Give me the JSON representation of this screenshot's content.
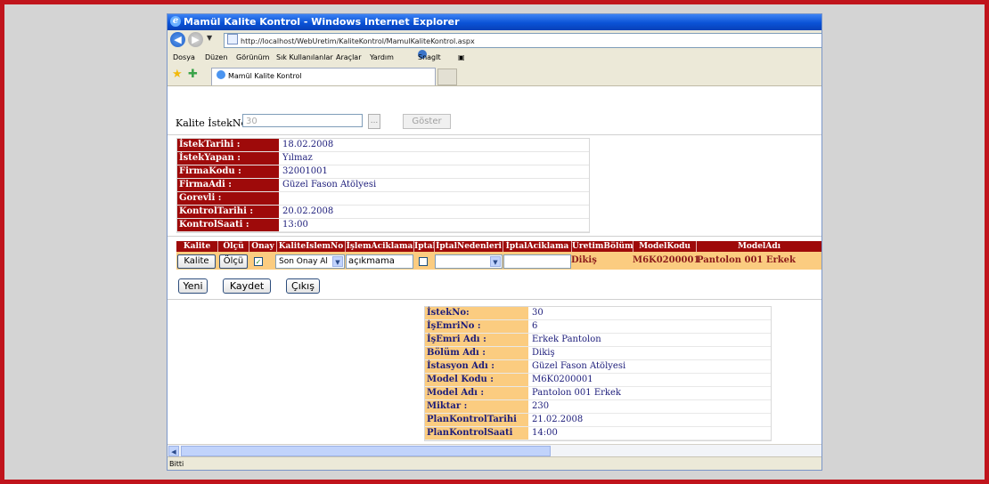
{
  "window": {
    "title": "Mamül Kalite Kontrol - Windows Internet Explorer"
  },
  "address": {
    "url": "http://localhost/WebUretim/KaliteKontrol/MamulKaliteKontrol.aspx"
  },
  "menu": {
    "items": [
      "Dosya",
      "Düzen",
      "Görünüm",
      "Sık Kullanılanlar",
      "Araçlar",
      "Yardım"
    ],
    "snagit": "SnagIt"
  },
  "tab": {
    "label": "Mamül Kalite Kontrol"
  },
  "search": {
    "label": "Kalite İstekNo",
    "value": "30",
    "dots": "...",
    "goster": "Göster"
  },
  "info": [
    {
      "k": "İstekTarihi :",
      "v": "18.02.2008"
    },
    {
      "k": "İstekYapan :",
      "v": "Yılmaz"
    },
    {
      "k": "FirmaKodu :",
      "v": "32001001"
    },
    {
      "k": "FirmaAdi :",
      "v": "Güzel Fason Atölyesi"
    },
    {
      "k": "Gorevli :",
      "v": ""
    },
    {
      "k": "KontrolTarihi :",
      "v": "20.02.2008"
    },
    {
      "k": "KontrolSaati :",
      "v": "13:00"
    }
  ],
  "grid": {
    "headers": [
      "Kalite",
      "Ölçü",
      "Onay",
      "KaliteIslemNo",
      "İşlemAciklama",
      "İptal",
      "İptalNedenleri",
      "İptalAciklama",
      "ÜretimBölüm",
      "ModelKodu",
      "ModelAdı"
    ],
    "row": {
      "kalite_btn": "Kalite",
      "olcu_btn": "Ölçü",
      "onay_check": "✓",
      "islem_select": "Son Onay Al",
      "islem_aciklama": "açıkmama",
      "iptal_nedeni": "",
      "iptal_aciklama": "",
      "uretim_bolum": "Dikiş",
      "model_kodu": "M6K0200001",
      "model_adi": "Pantolon 001 Erkek"
    }
  },
  "actions": {
    "yeni": "Yeni",
    "kaydet": "Kaydet",
    "cikis": "Çıkış"
  },
  "details": [
    {
      "k": "İstekNo:",
      "v": "30"
    },
    {
      "k": "İşEmriNo :",
      "v": "6"
    },
    {
      "k": "İşEmri Adı :",
      "v": "Erkek Pantolon"
    },
    {
      "k": "Bölüm Adı :",
      "v": "Dikiş"
    },
    {
      "k": "İstasyon Adı :",
      "v": "Güzel Fason Atölyesi"
    },
    {
      "k": "Model Kodu :",
      "v": "M6K0200001"
    },
    {
      "k": "Model Adı :",
      "v": "Pantolon 001 Erkek"
    },
    {
      "k": "Miktar :",
      "v": "230"
    },
    {
      "k": "PlanKontrolTarihi",
      "v": "21.02.2008"
    },
    {
      "k": "PlanKontrolSaati",
      "v": "14:00"
    }
  ],
  "status": {
    "text": "Bitti"
  }
}
